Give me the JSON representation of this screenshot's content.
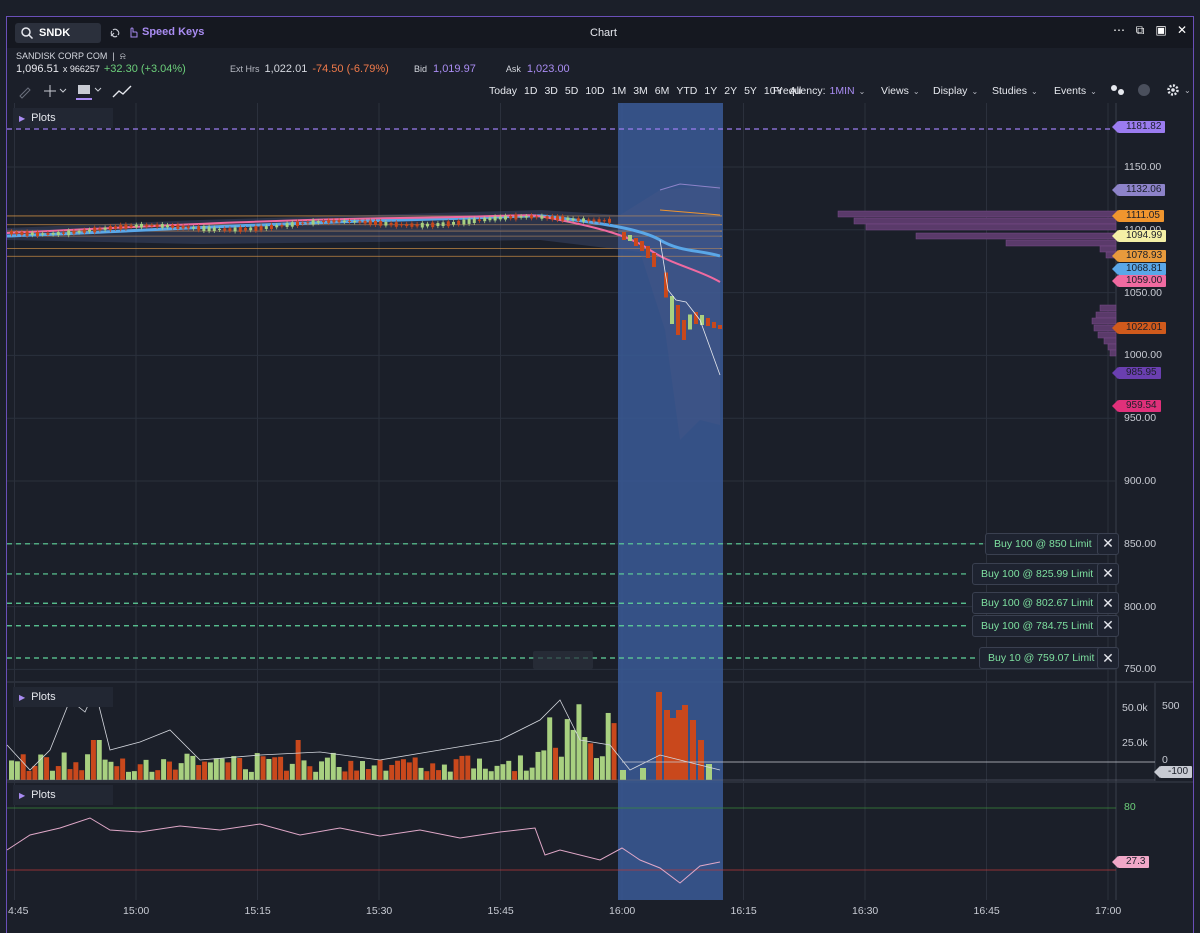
{
  "header": {
    "symbol": "SNDK",
    "speed_keys": "Speed Keys",
    "window_title": "Chart"
  },
  "quote": {
    "company": "SANDISK CORP COM",
    "last": "1,096.51",
    "volume": "x 966257",
    "change": "+32.30 (+3.04%)",
    "ext_label": "Ext Hrs",
    "ext_price": "1,022.01",
    "ext_change": "-74.50 (-6.79%)",
    "bid_label": "Bid",
    "bid": "1,019.97",
    "ask_label": "Ask",
    "ask": "1,023.00"
  },
  "toolbar": {
    "ranges": [
      "Today",
      "1D",
      "3D",
      "5D",
      "10D",
      "1M",
      "3M",
      "6M",
      "YTD",
      "1Y",
      "2Y",
      "5Y",
      "10Y",
      "All"
    ],
    "frequency_label": "Frequency:",
    "frequency_value": "1MIN",
    "views": "Views",
    "display": "Display",
    "studies": "Studies",
    "events": "Events"
  },
  "panels": {
    "plots_label": "Plots"
  },
  "price_axis": {
    "ticks": [
      "1150.00",
      "1100.00",
      "1050.00",
      "1000.00",
      "950.00",
      "900.00",
      "850.00",
      "800.00",
      "750.00"
    ]
  },
  "price_tags": [
    {
      "label": "1181.82",
      "color": "#9b7cf0"
    },
    {
      "label": "1132.06",
      "color": "#8d83c9"
    },
    {
      "label": "1111.05",
      "color": "#f0952e"
    },
    {
      "label": "1094.99",
      "color": "#f4f0a6"
    },
    {
      "label": "1078.93",
      "color": "#e89a3c"
    },
    {
      "label": "1068.81",
      "color": "#5aa7e8"
    },
    {
      "label": "1059.00",
      "color": "#f06aa0"
    },
    {
      "label": "1022.01",
      "color": "#d05a1c"
    },
    {
      "label": "985.95",
      "color": "#6a3fb0"
    },
    {
      "label": "959.54",
      "color": "#e0307a"
    }
  ],
  "orders": [
    {
      "label": "Buy 100 @ 850 Limit"
    },
    {
      "label": "Buy 100 @ 825.99 Limit"
    },
    {
      "label": "Buy 100 @ 802.67 Limit"
    },
    {
      "label": "Buy 100 @ 784.75 Limit"
    },
    {
      "label": "Buy 10 @ 759.07 Limit"
    }
  ],
  "volume_axis": {
    "ticks": [
      "50.0k",
      "25.0k"
    ],
    "osc_ticks": [
      "500",
      "0"
    ],
    "osc_tag": "-100"
  },
  "rsi_axis": {
    "ticks": [
      "80"
    ],
    "tag": "27.3"
  },
  "time_axis": {
    "ticks": [
      "4:45",
      "15:00",
      "15:15",
      "15:30",
      "15:45",
      "16:00",
      "16:15",
      "16:30",
      "16:45",
      "17:00"
    ]
  },
  "colors": {
    "up": "#a8d080",
    "down": "#c9481c",
    "accent": "#a98cf2",
    "highlight": "#3a5a96"
  }
}
